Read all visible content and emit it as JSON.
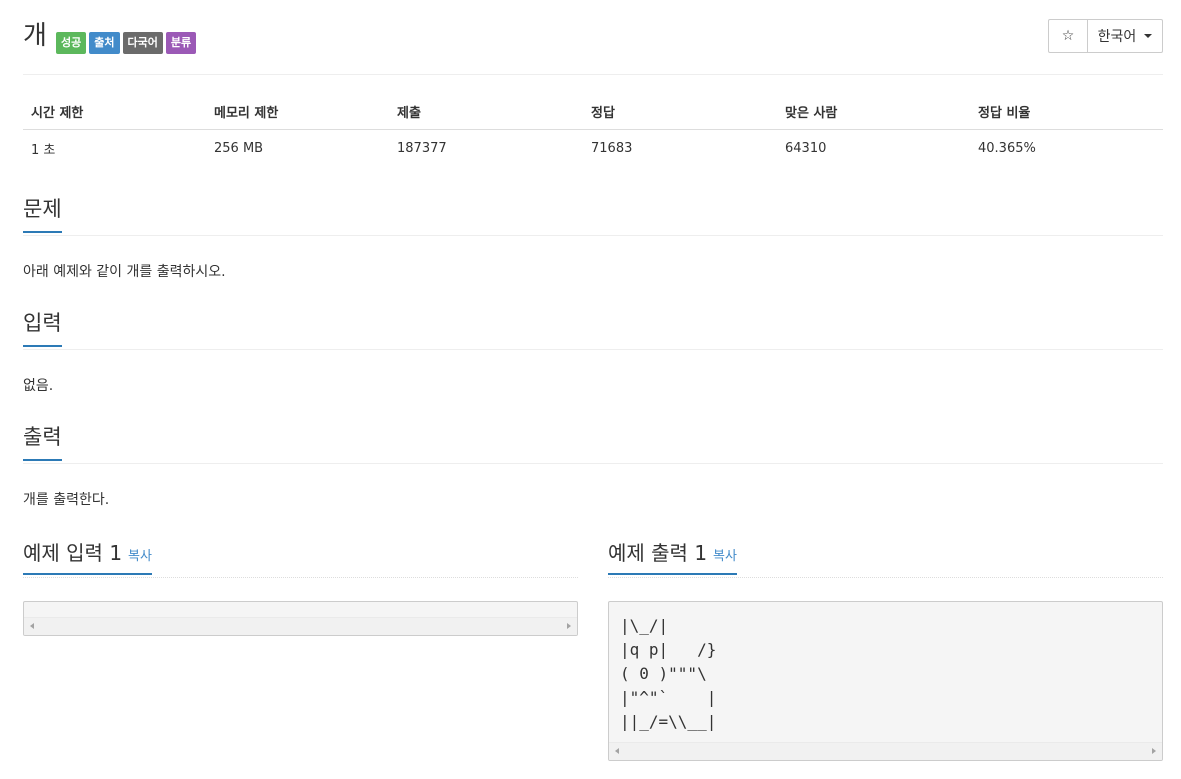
{
  "problem": {
    "title": "개",
    "labels": [
      {
        "text": "성공",
        "color": "#5cb85c"
      },
      {
        "text": "출처",
        "color": "#428bca"
      },
      {
        "text": "다국어",
        "color": "#6b6b6b"
      },
      {
        "text": "분류",
        "color": "#9b59b6"
      }
    ]
  },
  "toolbar": {
    "star_icon": "☆",
    "language": "한국어"
  },
  "stats": {
    "headers": [
      "시간 제한",
      "메모리 제한",
      "제출",
      "정답",
      "맞은 사람",
      "정답 비율"
    ],
    "values": [
      "1 초",
      "256 MB",
      "187377",
      "71683",
      "64310",
      "40.365%"
    ]
  },
  "sections": {
    "description": {
      "heading": "문제",
      "text": "아래 예제와 같이 개를 출력하시오."
    },
    "input": {
      "heading": "입력",
      "text": "없음."
    },
    "output": {
      "heading": "출력",
      "text": "개를 출력한다."
    }
  },
  "samples": {
    "input": {
      "heading": "예제 입력 1",
      "copy_label": "복사",
      "lines": []
    },
    "output": {
      "heading": "예제 출력 1",
      "copy_label": "복사",
      "lines": [
        "|\\_/|",
        "|q p|   /}",
        "( 0 )\"\"\"\\",
        "|\"^\"`    |",
        "||_/=\\\\__|"
      ]
    }
  },
  "accent_color": "#2c7ab6"
}
